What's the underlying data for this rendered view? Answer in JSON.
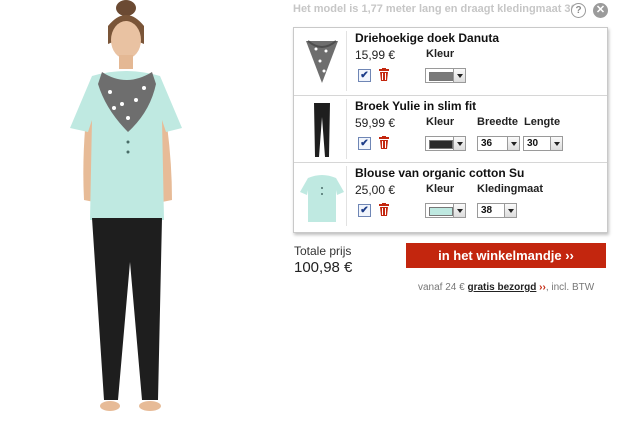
{
  "model_info": "Het model is 1,77 meter lang en draagt kledingmaat 36",
  "help_icon_text": "?",
  "close_icon_text": "✕",
  "check_glyph": "✔",
  "products": [
    {
      "name": "Driehoekige doek Danuta",
      "price": "15,99 €",
      "fields": [
        {
          "label": "Kleur",
          "type": "color",
          "color": "#7a7a7a"
        }
      ]
    },
    {
      "name": "Broek Yulie in slim fit",
      "price": "59,99 €",
      "fields": [
        {
          "label": "Kleur",
          "type": "color",
          "color": "#2a2a2a"
        },
        {
          "label": "Breedte",
          "type": "text",
          "value": "36"
        },
        {
          "label": "Lengte",
          "type": "text",
          "value": "30"
        }
      ]
    },
    {
      "name": "Blouse van organic cotton Su",
      "price": "25,00 €",
      "fields": [
        {
          "label": "Kleur",
          "type": "color",
          "color": "#bfe9e1"
        },
        {
          "label": "Kledingmaat",
          "type": "text",
          "value": "38"
        }
      ]
    }
  ],
  "total": {
    "label": "Totale prijs",
    "price": "100,98 €"
  },
  "cart_button": "in het winkelmandje ››",
  "shipping": {
    "prefix": "vanaf 24 € ",
    "link": "gratis bezorgd",
    "chevron": "››",
    "suffix": ", incl. BTW"
  },
  "colors": {
    "accent": "#c3260e",
    "blouse": "#bfe9e1",
    "trousers": "#1e1e1e",
    "scarf": "#6e6e6e"
  }
}
